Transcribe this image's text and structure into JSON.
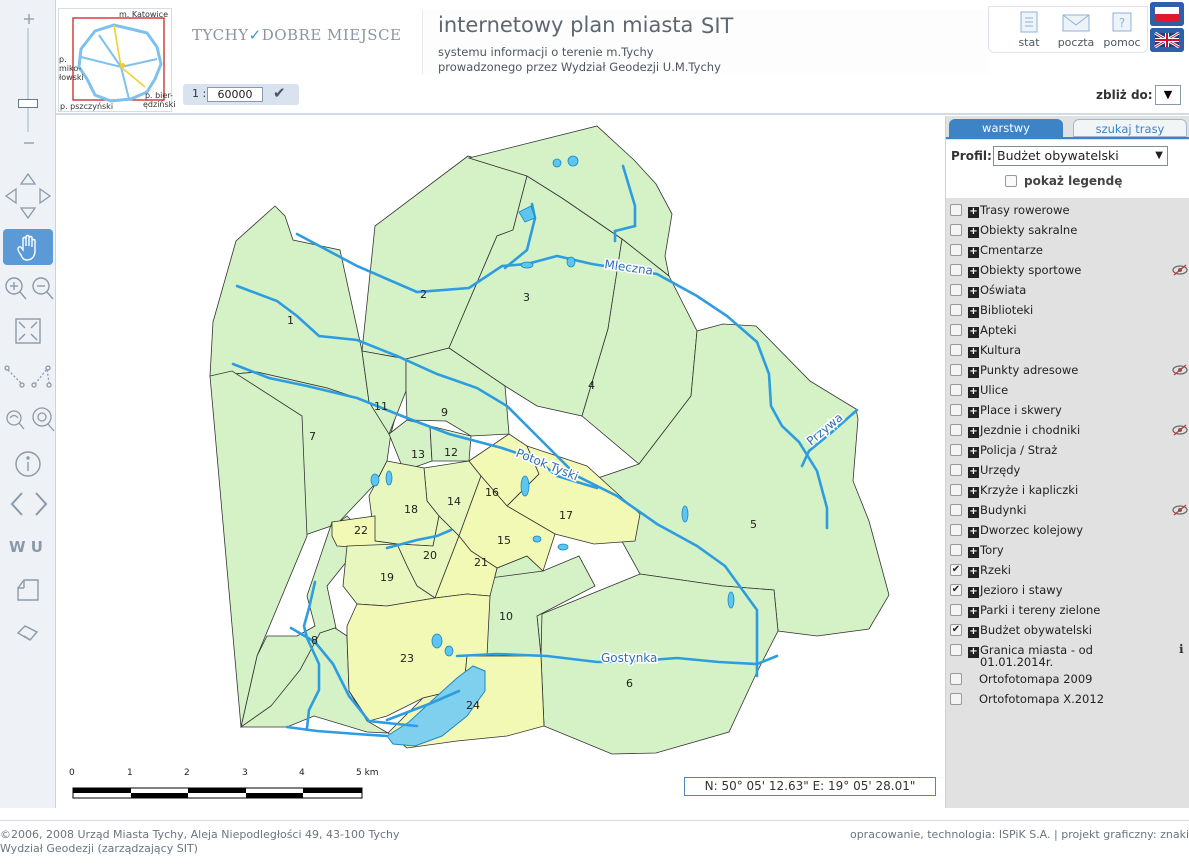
{
  "overview": {
    "labels": {
      "north": "m. Katowice",
      "west": "p. miko-łowski",
      "southwest": "p. pszczyński",
      "southeast": "p. bier-ędziński"
    }
  },
  "brand": {
    "left": "TYCHY",
    "right": "DOBRE MIEJSCE"
  },
  "title": {
    "main": "internetowy plan miasta",
    "sit": "SIT",
    "sub1": "systemu informacji o terenie m.Tychy",
    "sub2": "prowadzonego przez Wydział Geodezji U.M.Tychy"
  },
  "header_buttons": {
    "stat": "stat",
    "poczta": "poczta",
    "pomoc": "pomoc"
  },
  "scale": {
    "prefix": "1 :",
    "value": "60000"
  },
  "zoom_to": {
    "label": "zbliż do:"
  },
  "map": {
    "district_numbers": [
      "1",
      "2",
      "3",
      "4",
      "5",
      "6",
      "7",
      "8",
      "9",
      "10",
      "11",
      "12",
      "13",
      "14",
      "15",
      "16",
      "17",
      "18",
      "19",
      "20",
      "21",
      "22",
      "23",
      "24"
    ],
    "rivers": [
      "Mleczna",
      "Przywa",
      "Potok Tyski",
      "Gostynka"
    ],
    "scalebar_ticks": [
      "0",
      "1",
      "2",
      "3",
      "4",
      "5 km"
    ],
    "coordinates": "N: 50° 05' 12.63\" E: 19° 05' 28.01\""
  },
  "panel": {
    "tabs": {
      "layers": "warstwy",
      "routes": "szukaj trasy"
    },
    "profile_label": "Profil:",
    "profile_value": "Budżet obywatelski",
    "legend_label": "pokaż legendę",
    "layers": [
      {
        "label": "Trasy rowerowe",
        "checked": false,
        "eye": false
      },
      {
        "label": "Obiekty sakralne",
        "checked": false,
        "eye": false
      },
      {
        "label": "Cmentarze",
        "checked": false,
        "eye": false
      },
      {
        "label": "Obiekty sportowe",
        "checked": false,
        "eye": true
      },
      {
        "label": "Oświata",
        "checked": false,
        "eye": false
      },
      {
        "label": "Biblioteki",
        "checked": false,
        "eye": false
      },
      {
        "label": "Apteki",
        "checked": false,
        "eye": false
      },
      {
        "label": "Kultura",
        "checked": false,
        "eye": false
      },
      {
        "label": "Punkty adresowe",
        "checked": false,
        "eye": true
      },
      {
        "label": "Ulice",
        "checked": false,
        "eye": false
      },
      {
        "label": "Place i skwery",
        "checked": false,
        "eye": false
      },
      {
        "label": "Jezdnie i chodniki",
        "checked": false,
        "eye": true
      },
      {
        "label": "Policja / Straż",
        "checked": false,
        "eye": false
      },
      {
        "label": "Urzędy",
        "checked": false,
        "eye": false
      },
      {
        "label": "Krzyże i kapliczki",
        "checked": false,
        "eye": false
      },
      {
        "label": "Budynki",
        "checked": false,
        "eye": true
      },
      {
        "label": "Dworzec kolejowy",
        "checked": false,
        "eye": false
      },
      {
        "label": "Tory",
        "checked": false,
        "eye": false
      },
      {
        "label": "Rzeki",
        "checked": true,
        "eye": false
      },
      {
        "label": "Jezioro i stawy",
        "checked": true,
        "eye": false
      },
      {
        "label": "Parki i tereny zielone",
        "checked": false,
        "eye": false
      },
      {
        "label": "Budżet obywatelski",
        "checked": true,
        "eye": false
      }
    ],
    "granica_line1": "Granica miasta - od",
    "granica_line2": "01.01.2014r.",
    "ortho1": "Ortofotomapa 2009",
    "ortho2": "Ortofotomapa X.2012"
  },
  "footer": {
    "left1": "©2006, 2008 Urząd Miasta Tychy, Aleja Niepodległości 49, 43-100 Tychy",
    "left2": "Wydział Geodezji (zarządzający SIT)",
    "right": "opracowanie, technologia: ISPiK S.A. | projekt graficzny: znaki"
  },
  "colors": {
    "district_green": "#d4f2c6",
    "district_yellow": "#f2f9b5",
    "river": "#2d9ce0",
    "accent": "#3d83c5"
  }
}
